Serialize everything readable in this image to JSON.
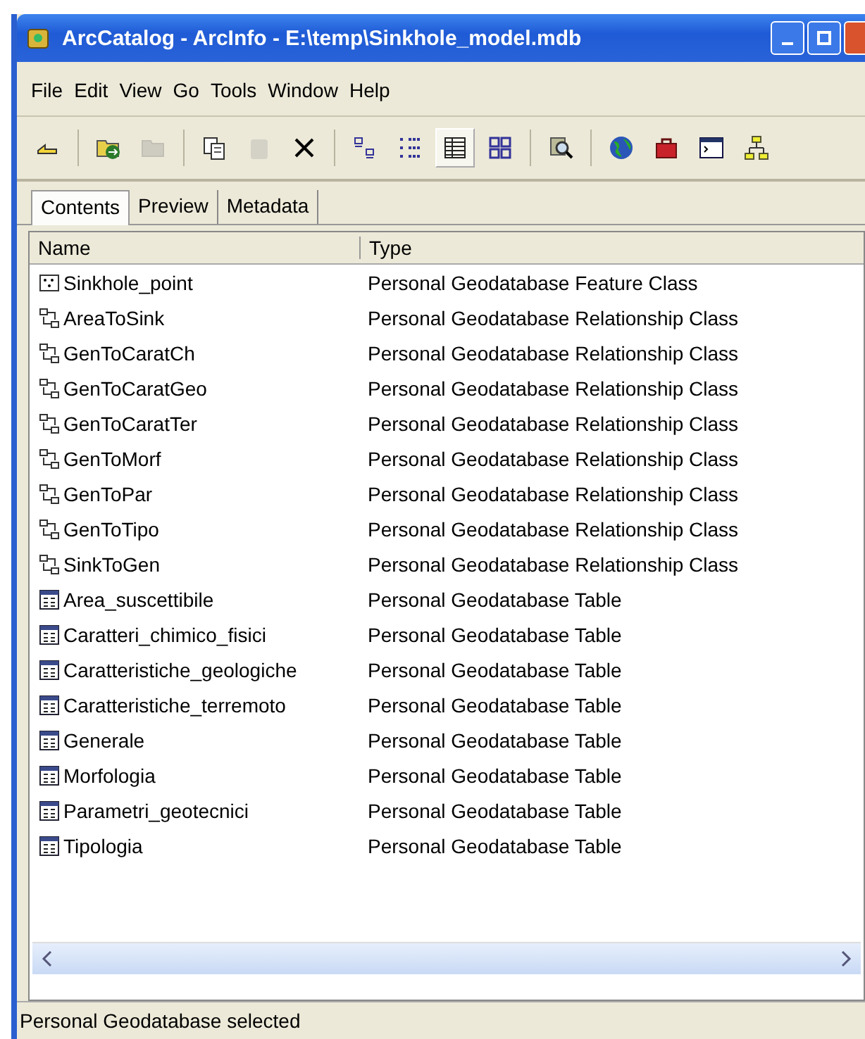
{
  "window": {
    "title": "ArcCatalog - ArcInfo - E:\\temp\\Sinkhole_model.mdb"
  },
  "menu": [
    "File",
    "Edit",
    "View",
    "Go",
    "Tools",
    "Window",
    "Help"
  ],
  "toolbar": [
    {
      "kind": "up",
      "disabled": false,
      "selected": false
    },
    {
      "kind": "sep"
    },
    {
      "kind": "connect",
      "disabled": false,
      "selected": false
    },
    {
      "kind": "disconnect",
      "disabled": true,
      "selected": false
    },
    {
      "kind": "sep"
    },
    {
      "kind": "copy",
      "disabled": false,
      "selected": false
    },
    {
      "kind": "paste",
      "disabled": true,
      "selected": false
    },
    {
      "kind": "delete",
      "disabled": false,
      "selected": false
    },
    {
      "kind": "sep"
    },
    {
      "kind": "large",
      "disabled": false,
      "selected": false
    },
    {
      "kind": "list",
      "disabled": false,
      "selected": false
    },
    {
      "kind": "details",
      "disabled": false,
      "selected": true
    },
    {
      "kind": "thumbs",
      "disabled": false,
      "selected": false
    },
    {
      "kind": "sep"
    },
    {
      "kind": "search",
      "disabled": false,
      "selected": false
    },
    {
      "kind": "sep"
    },
    {
      "kind": "globe",
      "disabled": false,
      "selected": false
    },
    {
      "kind": "toolbox",
      "disabled": false,
      "selected": false
    },
    {
      "kind": "command",
      "disabled": false,
      "selected": false
    },
    {
      "kind": "model",
      "disabled": false,
      "selected": false
    }
  ],
  "tabs": [
    {
      "label": "Contents",
      "selected": true
    },
    {
      "label": "Preview",
      "selected": false
    },
    {
      "label": "Metadata",
      "selected": false
    }
  ],
  "table": {
    "columns": [
      "Name",
      "Type"
    ],
    "rows": [
      {
        "kind": "feature",
        "name": "Sinkhole_point",
        "type": "Personal Geodatabase Feature Class"
      },
      {
        "kind": "relationship",
        "name": "AreaToSink",
        "type": "Personal Geodatabase Relationship Class"
      },
      {
        "kind": "relationship",
        "name": "GenToCaratCh",
        "type": "Personal Geodatabase Relationship Class"
      },
      {
        "kind": "relationship",
        "name": "GenToCaratGeo",
        "type": "Personal Geodatabase Relationship Class"
      },
      {
        "kind": "relationship",
        "name": "GenToCaratTer",
        "type": "Personal Geodatabase Relationship Class"
      },
      {
        "kind": "relationship",
        "name": "GenToMorf",
        "type": "Personal Geodatabase Relationship Class"
      },
      {
        "kind": "relationship",
        "name": "GenToPar",
        "type": "Personal Geodatabase Relationship Class"
      },
      {
        "kind": "relationship",
        "name": "GenToTipo",
        "type": "Personal Geodatabase Relationship Class"
      },
      {
        "kind": "relationship",
        "name": "SinkToGen",
        "type": "Personal Geodatabase Relationship Class"
      },
      {
        "kind": "table",
        "name": "Area_suscettibile",
        "type": "Personal Geodatabase Table"
      },
      {
        "kind": "table",
        "name": "Caratteri_chimico_fisici",
        "type": "Personal Geodatabase Table"
      },
      {
        "kind": "table",
        "name": "Caratteristiche_geologiche",
        "type": "Personal Geodatabase Table"
      },
      {
        "kind": "table",
        "name": "Caratteristiche_terremoto",
        "type": "Personal Geodatabase Table"
      },
      {
        "kind": "table",
        "name": "Generale",
        "type": "Personal Geodatabase Table"
      },
      {
        "kind": "table",
        "name": "Morfologia",
        "type": "Personal Geodatabase Table"
      },
      {
        "kind": "table",
        "name": "Parametri_geotecnici",
        "type": "Personal Geodatabase Table"
      },
      {
        "kind": "table",
        "name": "Tipologia",
        "type": "Personal Geodatabase Table"
      }
    ]
  },
  "status_bar": "Personal Geodatabase selected"
}
